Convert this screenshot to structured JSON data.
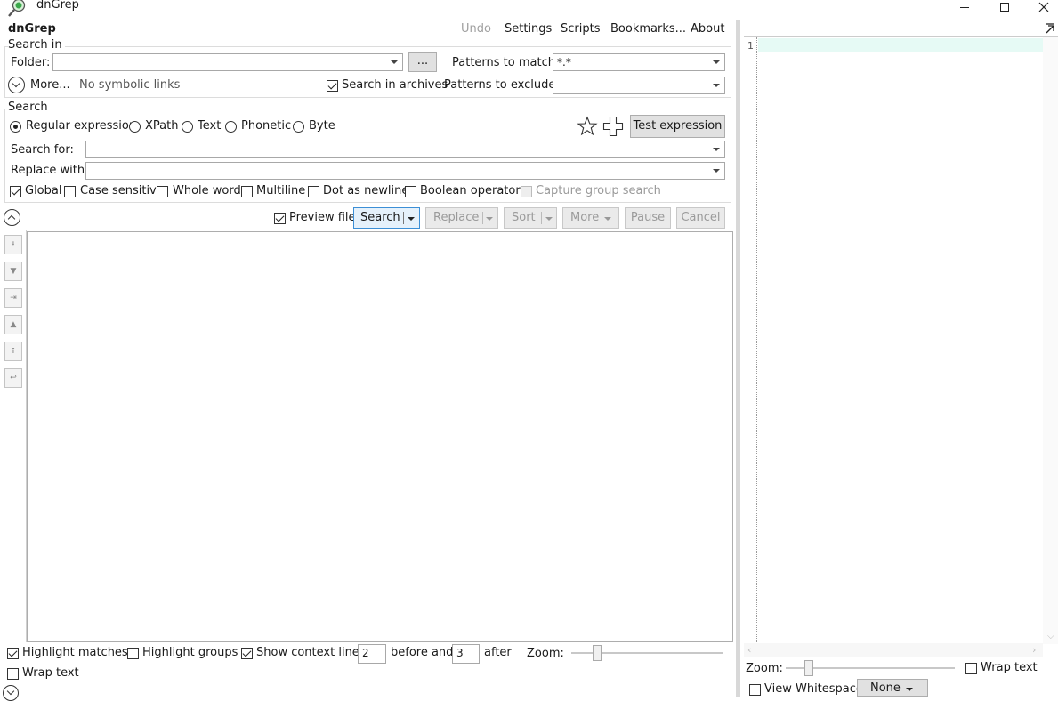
{
  "window": {
    "title": "dnGrep"
  },
  "menu": {
    "app_name": "dnGrep",
    "undo": "Undo",
    "settings": "Settings",
    "scripts": "Scripts",
    "bookmarks": "Bookmarks...",
    "about": "About"
  },
  "search_in": {
    "title": "Search in",
    "folder_label": "Folder:",
    "folder_value": "",
    "browse_label": "...",
    "patterns_match_label": "Patterns to match:",
    "patterns_match_value": "*.*",
    "more_label": "More...",
    "symlinks_text": "No symbolic links",
    "search_archives_label": "Search in archives",
    "search_archives_checked": true,
    "patterns_exclude_label": "Patterns to exclude:",
    "patterns_exclude_value": ""
  },
  "search": {
    "title": "Search",
    "types": [
      {
        "label": "Regular expression",
        "checked": true
      },
      {
        "label": "XPath",
        "checked": false
      },
      {
        "label": "Text",
        "checked": false
      },
      {
        "label": "Phonetic",
        "checked": false
      },
      {
        "label": "Byte",
        "checked": false
      }
    ],
    "test_expression_label": "Test expression",
    "search_for_label": "Search for:",
    "search_for_value": "",
    "replace_with_label": "Replace with:",
    "replace_with_value": "",
    "options": [
      {
        "label": "Global",
        "checked": true,
        "enabled": true
      },
      {
        "label": "Case sensitive",
        "checked": false,
        "enabled": true
      },
      {
        "label": "Whole word",
        "checked": false,
        "enabled": true
      },
      {
        "label": "Multiline",
        "checked": false,
        "enabled": true
      },
      {
        "label": "Dot as newline",
        "checked": false,
        "enabled": true
      },
      {
        "label": "Boolean operators",
        "checked": false,
        "enabled": true
      },
      {
        "label": "Capture group search",
        "checked": false,
        "enabled": false
      }
    ]
  },
  "actions": {
    "preview_file_label": "Preview file",
    "preview_file_checked": true,
    "search_label": "Search",
    "replace_label": "Replace",
    "sort_label": "Sort",
    "more_label": "More",
    "pause_label": "Pause",
    "cancel_label": "Cancel"
  },
  "results_footer": {
    "highlight_matches_label": "Highlight matches",
    "highlight_matches_checked": true,
    "highlight_groups_label": "Highlight groups",
    "highlight_groups_checked": false,
    "show_context_label": "Show context lines",
    "show_context_checked": true,
    "before_value": "2",
    "before_and_label": "before and",
    "after_value": "3",
    "after_label": "after",
    "zoom_label": "Zoom:",
    "wrap_text_label": "Wrap text",
    "wrap_text_checked": false
  },
  "preview": {
    "line_number": "1",
    "zoom_label": "Zoom:",
    "wrap_text_label": "Wrap text",
    "wrap_text_checked": false,
    "view_whitespace_label": "View Whitespace",
    "view_whitespace_checked": false,
    "syntax_value": "None"
  },
  "colors": {
    "accent": "#3c8fd6",
    "line_highlight": "#e6faf5",
    "icon_green": "#3aa84a"
  }
}
